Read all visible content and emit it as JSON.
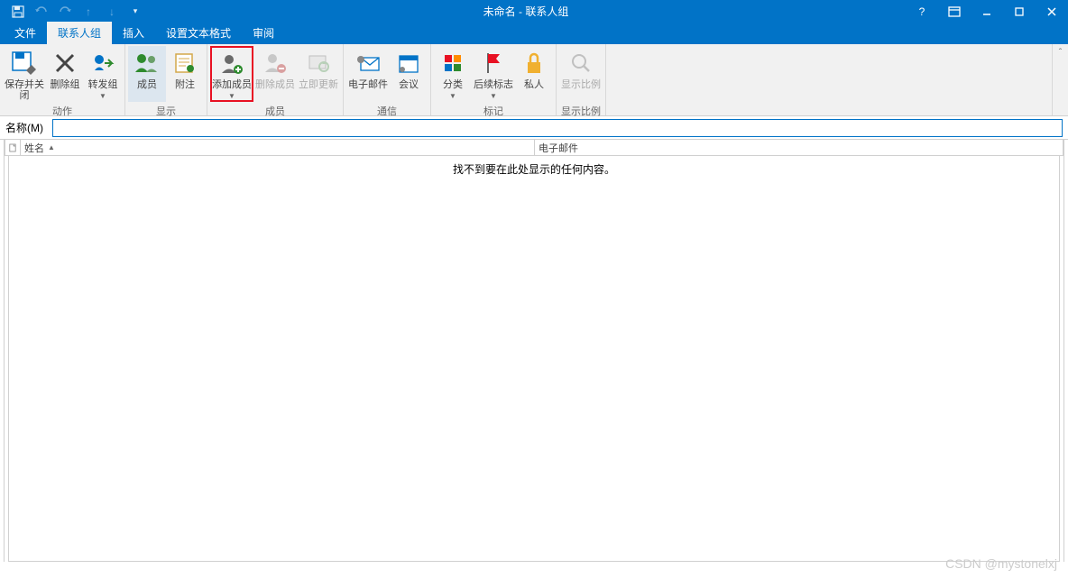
{
  "title": "未命名 - 联系人组",
  "qat": {
    "save": "保存",
    "undo": "撤销",
    "redo": "重做",
    "up": "上",
    "down": "下"
  },
  "win": {
    "help": "?",
    "ribbon": "⬚",
    "min": "—",
    "max": "□",
    "close": "✕"
  },
  "tabs": [
    "文件",
    "联系人组",
    "插入",
    "设置文本格式",
    "审阅"
  ],
  "active_tab": 1,
  "ribbon": {
    "groups": [
      {
        "label": "动作",
        "buttons": [
          {
            "name": "save-close",
            "label": "保存并关闭"
          },
          {
            "name": "delete-group",
            "label": "删除组"
          },
          {
            "name": "forward-group",
            "label": "转发组",
            "dropdown": true
          }
        ]
      },
      {
        "label": "显示",
        "buttons": [
          {
            "name": "members",
            "label": "成员",
            "active": true
          },
          {
            "name": "notes",
            "label": "附注"
          }
        ]
      },
      {
        "label": "成员",
        "buttons": [
          {
            "name": "add-member",
            "label": "添加成员",
            "dropdown": true,
            "highlighted": true
          },
          {
            "name": "remove-member",
            "label": "删除成员",
            "disabled": true
          },
          {
            "name": "update-now",
            "label": "立即更新",
            "disabled": true
          }
        ]
      },
      {
        "label": "通信",
        "buttons": [
          {
            "name": "email",
            "label": "电子邮件"
          },
          {
            "name": "meeting",
            "label": "会议"
          }
        ]
      },
      {
        "label": "标记",
        "buttons": [
          {
            "name": "categorize",
            "label": "分类",
            "dropdown": true
          },
          {
            "name": "followup",
            "label": "后续标志",
            "dropdown": true
          },
          {
            "name": "private",
            "label": "私人"
          }
        ]
      },
      {
        "label": "显示比例",
        "buttons": [
          {
            "name": "zoom",
            "label": "显示比例",
            "disabled": true
          }
        ]
      }
    ]
  },
  "form": {
    "name_label": "名称(M)",
    "name_value": ""
  },
  "columns": {
    "name": "姓名",
    "email": "电子邮件"
  },
  "empty_message": "找不到要在此处显示的任何内容。",
  "watermark": "CSDN @mystonelxj"
}
